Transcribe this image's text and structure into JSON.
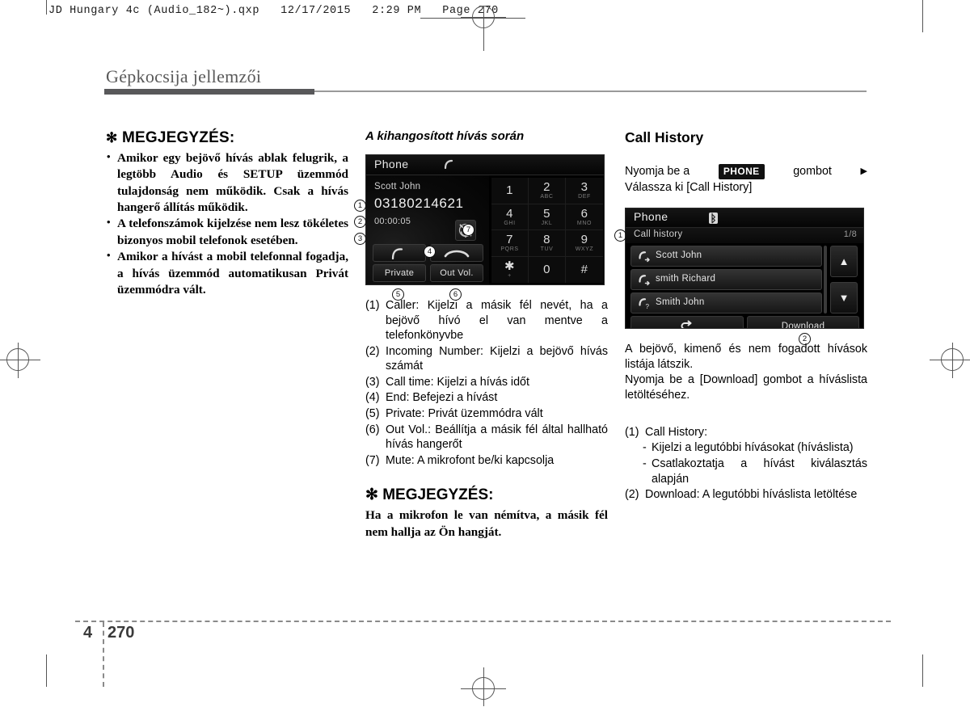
{
  "print_header": {
    "text": "JD Hungary 4c (Audio_182~).qxp   12/17/2015   2:29 PM   Page 270"
  },
  "section": {
    "title": "Gépkocsija jellemzői"
  },
  "footer": {
    "chapter": "4",
    "page": "270"
  },
  "left_column": {
    "note_heading": "MEGJEGYZÉS:",
    "asterisk": "✻",
    "bullets": [
      "Amikor egy bejövő hívás ablak felugrik, a legtöbb Audio és SETUP üzemmód tulajdonság nem működik. Csak a hívás hangerő állítás működik.",
      "A telefonszámok kijelzése nem lesz tökéletes bizonyos mobil telefonok esetében.",
      "Amikor a hívást a mobil telefonnal fogadja, a hívás üzemmód automatikusan Privát üzemmódra vált."
    ]
  },
  "middle_column": {
    "heading": "A kihangosított hívás során",
    "phone_screen": {
      "title": "Phone",
      "call_icon": "incoming-call-icon",
      "caller_name": "Scott John",
      "number": "03180214621",
      "call_time": "00:00:05",
      "mute_icon": "mute-microphone-icon",
      "accept_icon": "call-accept-icon",
      "end_icon": "call-end-icon",
      "private_label": "Private",
      "out_vol_label": "Out Vol.",
      "keypad": [
        {
          "digit": "1",
          "letters": ""
        },
        {
          "digit": "2",
          "letters": "ABC"
        },
        {
          "digit": "3",
          "letters": "DEF"
        },
        {
          "digit": "4",
          "letters": "GHI"
        },
        {
          "digit": "5",
          "letters": "JKL"
        },
        {
          "digit": "6",
          "letters": "MNO"
        },
        {
          "digit": "7",
          "letters": "PQRS"
        },
        {
          "digit": "8",
          "letters": "TUV"
        },
        {
          "digit": "9",
          "letters": "WXYZ"
        },
        {
          "digit": "✱",
          "letters": "+"
        },
        {
          "digit": "0",
          "letters": ""
        },
        {
          "digit": "#",
          "letters": ""
        }
      ],
      "callouts": [
        "1",
        "2",
        "3",
        "4",
        "5",
        "6",
        "7"
      ]
    },
    "descriptions": [
      {
        "num": "(1)",
        "text": "Caller: Kijelzi a másik fél nevét, ha a bejövő hívó el van mentve a telefonkönyvbe"
      },
      {
        "num": "(2)",
        "text": "Incoming Number: Kijelzi a bejövő hívás számát"
      },
      {
        "num": "(3)",
        "text": "Call time: Kijelzi a hívás időt"
      },
      {
        "num": "(4)",
        "text": "End: Befejezi a hívást"
      },
      {
        "num": "(5)",
        "text": "Private: Privát üzemmódra vált"
      },
      {
        "num": "(6)",
        "text": "Out Vol.: Beállítja a másik fél által hallható hívás hangerőt"
      },
      {
        "num": "(7)",
        "text": "Mute: A mikrofont be/ki kapcsolja"
      }
    ],
    "note_heading": "MEGJEGYZÉS:",
    "note_body": "Ha a mikrofon le van némítva, a másik fél nem hallja az Ön hangját."
  },
  "right_column": {
    "heading": "Call History",
    "instruction_pre": "Nyomja be a",
    "instruction_key": "PHONE",
    "instruction_post": "gombot",
    "instruction_arrow": "▶",
    "instruction_line2": "Válassza ki [Call History]",
    "history_screen": {
      "title": "Phone",
      "bluetooth_icon": "bluetooth-icon",
      "subtitle": "Call history",
      "page_indicator": "1/8",
      "rows": [
        {
          "icon": "outgoing-call-icon",
          "name": "Scott John"
        },
        {
          "icon": "outgoing-call-icon",
          "name": "smith Richard"
        },
        {
          "icon": "missed-call-icon",
          "name": "Smith John"
        }
      ],
      "scroll_up": "▲",
      "scroll_down": "▼",
      "back_label": "↰",
      "download_label": "Download",
      "callouts": [
        "1",
        "2"
      ]
    },
    "paragraph1": "A bejövő, kimenő és nem fogadott hívások listája látszik.",
    "paragraph2": "Nyomja be a [Download] gombot a híváslista letöltéséhez.",
    "descriptions": [
      {
        "num": "(1)",
        "text": "Call History:",
        "subs": [
          "Kijelzi a legutóbbi hívásokat (híváslista)",
          "Csatlakoztatja a hívást kiválasztás alapján"
        ]
      },
      {
        "num": "(2)",
        "text": "Download: A legutóbbi híváslista letöltése",
        "subs": []
      }
    ]
  }
}
